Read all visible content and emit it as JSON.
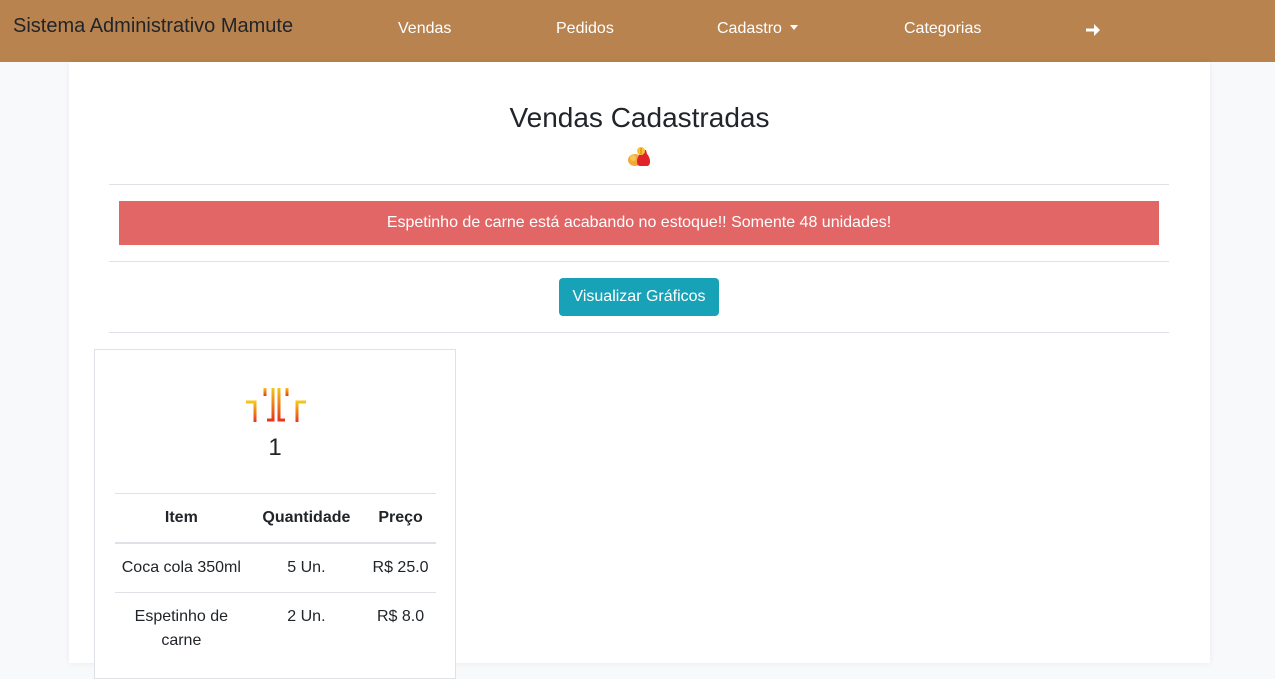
{
  "navbar": {
    "brand": "Sistema Administrativo Mamute",
    "links": [
      {
        "label": "Vendas"
      },
      {
        "label": "Pedidos"
      },
      {
        "label": "Cadastro"
      },
      {
        "label": "Categorias"
      }
    ],
    "logout_icon": "arrow-right-icon",
    "background": "#b8834f"
  },
  "page": {
    "title": "Vendas Cadastradas",
    "title_icon": "money-bag-icon"
  },
  "alert": {
    "message": "Espetinho de carne está acabando no estoque!! Somente 48 unidades!",
    "color": "#e36666"
  },
  "charts_button": {
    "label": "Visualizar Gráficos",
    "color": "#17a2b8"
  },
  "sale_card": {
    "icon": "dining-table-icon",
    "table_number": "1",
    "headers": [
      "Item",
      "Quantidade",
      "Preço"
    ],
    "rows": [
      {
        "item": "Coca cola 350ml",
        "quantity": "5 Un.",
        "price": "R$ 25.0"
      },
      {
        "item": "Espetinho de carne",
        "quantity": "2 Un.",
        "price": "R$ 8.0"
      }
    ]
  }
}
